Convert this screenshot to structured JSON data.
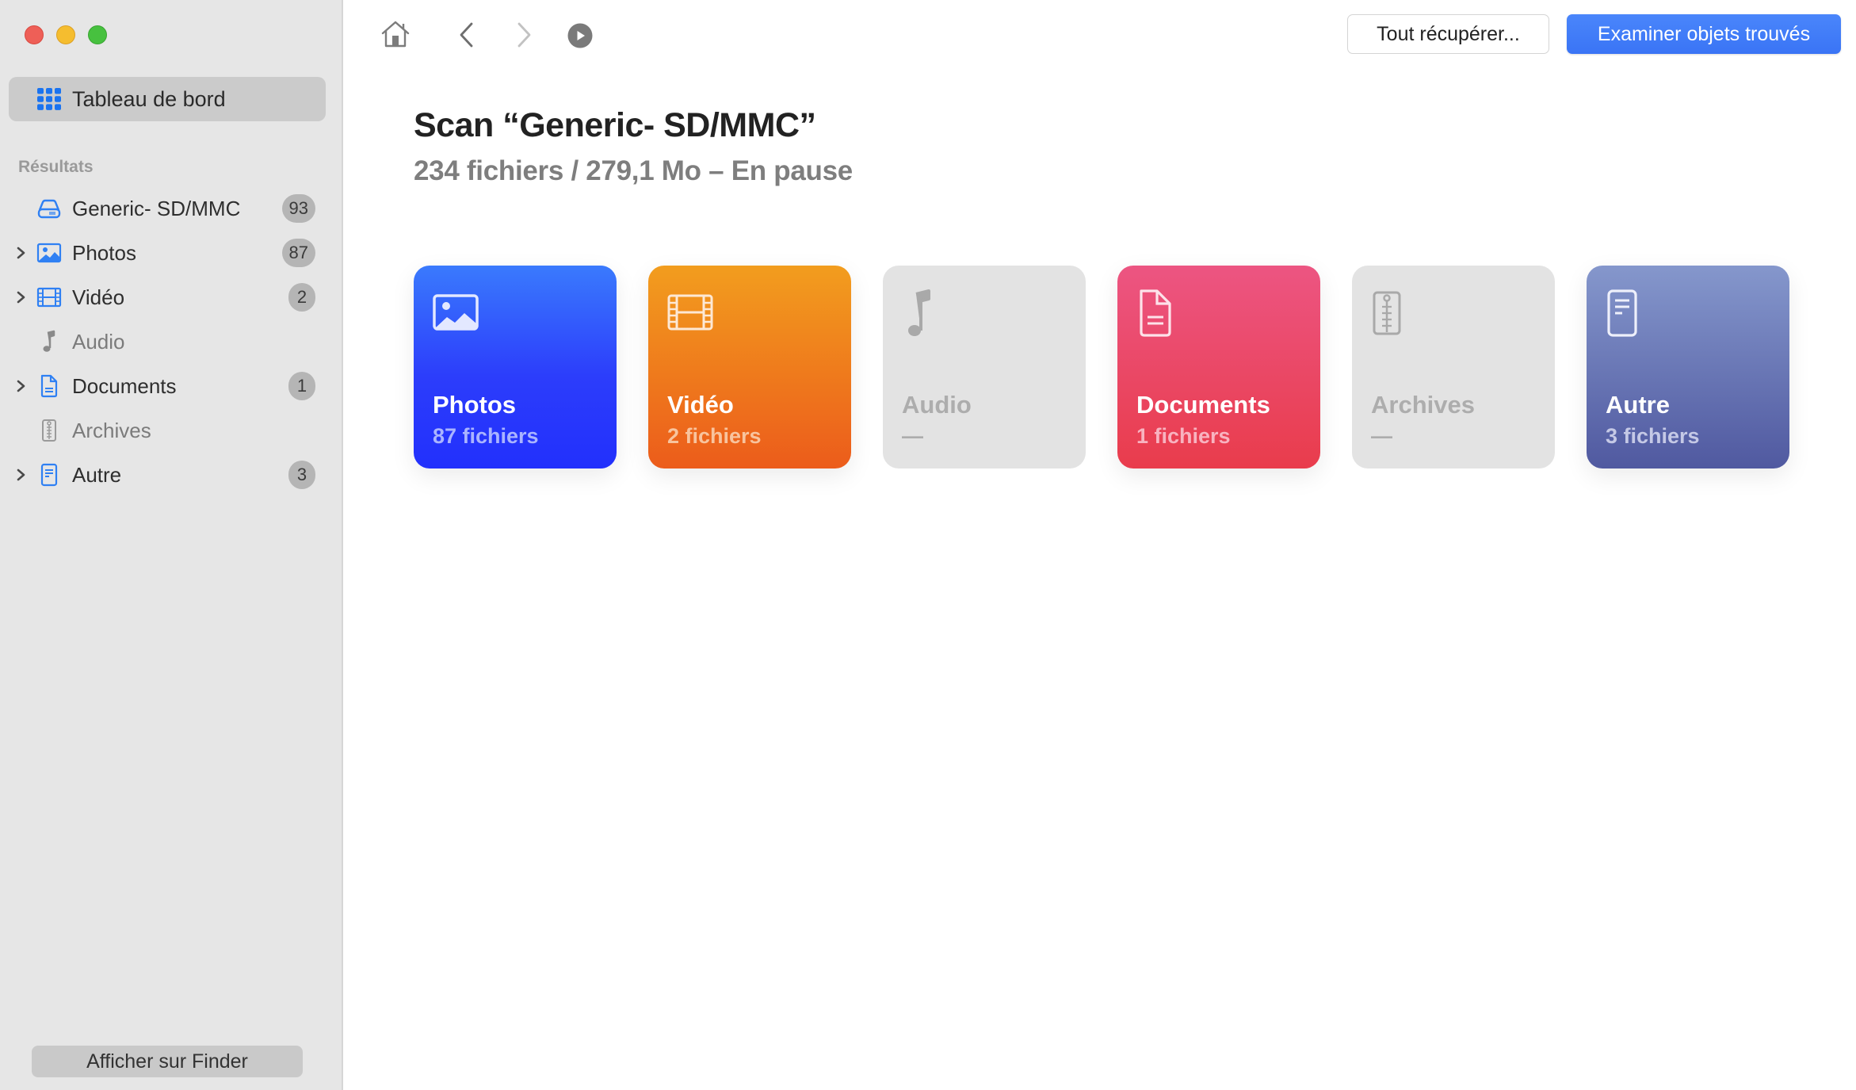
{
  "window": {
    "controls": [
      "close",
      "minimize",
      "maximize"
    ]
  },
  "sidebar": {
    "dashboard_label": "Tableau de bord",
    "section_label": "Résultats",
    "items": [
      {
        "label": "Generic- SD/MMC",
        "count": "93",
        "icon": "drive-icon",
        "expandable": false,
        "enabled": true
      },
      {
        "label": "Photos",
        "count": "87",
        "icon": "photo-icon",
        "expandable": true,
        "enabled": true
      },
      {
        "label": "Vidéo",
        "count": "2",
        "icon": "film-icon",
        "expandable": true,
        "enabled": true
      },
      {
        "label": "Audio",
        "count": null,
        "icon": "music-note-icon",
        "expandable": false,
        "enabled": false
      },
      {
        "label": "Documents",
        "count": "1",
        "icon": "document-icon",
        "expandable": true,
        "enabled": true
      },
      {
        "label": "Archives",
        "count": null,
        "icon": "zip-archive-icon",
        "expandable": false,
        "enabled": false
      },
      {
        "label": "Autre",
        "count": "3",
        "icon": "text-file-icon",
        "expandable": true,
        "enabled": true
      }
    ],
    "finder_button": "Afficher sur Finder"
  },
  "toolbar": {
    "icons": [
      "home-icon",
      "back-icon",
      "forward-icon",
      "play-icon"
    ],
    "recover_all_label": "Tout récupérer...",
    "review_label": "Examiner objets trouvés",
    "accent": "#3b78f7"
  },
  "scan": {
    "title": "Scan “Generic- SD/MMC”",
    "summary": "234 fichiers / 279,1 Mo – En pause"
  },
  "cards": [
    {
      "name": "Photos",
      "count": "87 fichiers",
      "icon": "photo-icon",
      "color": "#2c3dfb"
    },
    {
      "name": "Vidéo",
      "count": "2 fichiers",
      "icon": "film-icon",
      "color": "#ee7a1d"
    },
    {
      "name": "Audio",
      "count": "—",
      "icon": "music-note-icon",
      "color": "#e3e3e3"
    },
    {
      "name": "Documents",
      "count": "1 fichiers",
      "icon": "document-icon",
      "color": "#ea4866"
    },
    {
      "name": "Archives",
      "count": "—",
      "icon": "zip-archive-icon",
      "color": "#e3e3e3"
    },
    {
      "name": "Autre",
      "count": "3 fichiers",
      "icon": "text-file-icon",
      "color": "#6a76b6"
    }
  ]
}
